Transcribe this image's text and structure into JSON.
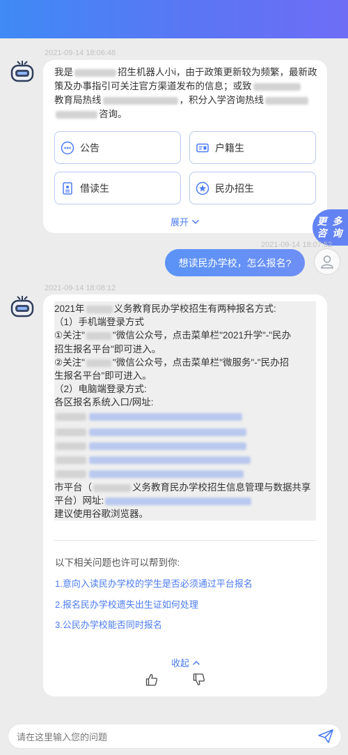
{
  "header": {
    "bg_start": "#3f8af5",
    "bg_end": "#6e6df6"
  },
  "messages": [
    {
      "timestamp": "2021-09-14 18:06:48",
      "text_parts": [
        "我是",
        "招生机器人小i，由于政策更新较为频繁，最新政策及办事指引可关注官方渠道发布的信息；或致",
        "教育局热线",
        "，积分入学咨询热线",
        "咨询。"
      ]
    }
  ],
  "categories": [
    {
      "label": "公告",
      "icon": "message-dots-icon"
    },
    {
      "label": "户籍生",
      "icon": "id-card-icon"
    },
    {
      "label": "借读生",
      "icon": "document-icon"
    },
    {
      "label": "民办招生",
      "icon": "star-badge-icon"
    }
  ],
  "expand_label": "展开",
  "more_button": {
    "line1": "更 多",
    "line2": "咨 询"
  },
  "user_message": {
    "timestamp": "2021-09-14 18:07:52",
    "text": "想读民办学校，怎么报名?"
  },
  "answer": {
    "timestamp": "2021-09-14 18:08:12",
    "line1b": "义务教育民办学校招生有两种报名方式:",
    "line1a": "2021年",
    "line2": "（1）手机端登录方式",
    "line3a": "①关注\"",
    "line3b": "\"微信公众号，点击菜单栏\"2021升学\"-\"民办",
    "line4": "招生报名平台\"即可进入。",
    "line5a": "②关注\"",
    "line5b": "\"微信公众号，点击菜单栏\"微服务\"-\"民办招",
    "line6": "生报名平台\"即可进入。",
    "line7": "（2）电脑端登录方式:",
    "line8": "各区报名系统入口/网址:",
    "line14a": "市平台（",
    "line14b": "义务教育民办学校招生信息管理与数据共享",
    "line15": "平台）网址:",
    "line16": "建议使用谷歌浏览器。"
  },
  "related": {
    "title": "以下相关问题也许可以帮到你:",
    "items": [
      "1.意向入读民办学校的学生是否必须通过平台报名",
      "2.报名民办学校遗失出生证如何处理",
      "3.公民办学校能否同时报名"
    ]
  },
  "collapse_label": "收起",
  "input": {
    "placeholder": "请在这里输入您的问题",
    "value": ""
  }
}
